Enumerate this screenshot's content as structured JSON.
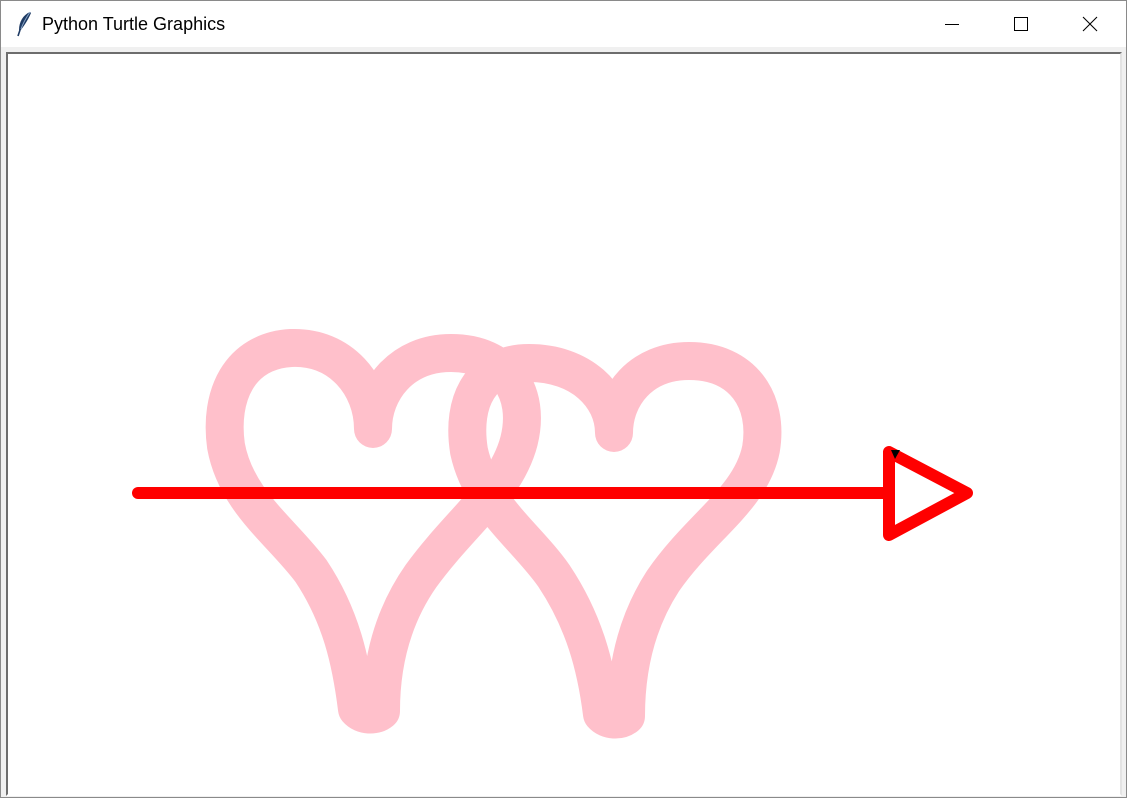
{
  "window": {
    "title": "Python Turtle Graphics",
    "app_icon": "feather-icon",
    "controls": {
      "minimize": "minimize-icon",
      "maximize": "maximize-icon",
      "close": "close-icon"
    }
  },
  "canvas": {
    "background": "#ffffff",
    "drawing": {
      "hearts": {
        "color": "#ffc0cb",
        "count": 2
      },
      "arrow": {
        "color": "#ff0000",
        "head": "triangle"
      },
      "turtle_cursor": {
        "color": "#000000",
        "shape": "classic"
      }
    }
  }
}
